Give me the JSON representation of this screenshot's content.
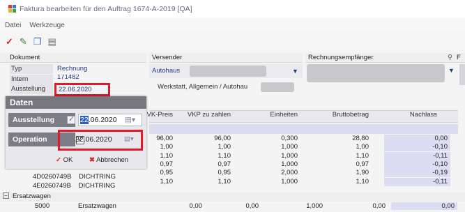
{
  "window": {
    "title": "Faktura bearbeiten für den Auftrag 1674-A-2019 [QA]"
  },
  "menu": {
    "items": [
      "Datei",
      "Werkzeuge"
    ]
  },
  "dokument": {
    "header": "Dokument",
    "typ_label": "Typ",
    "typ_value": "Rechnung",
    "intern_label": "Intern",
    "intern_value": "171482",
    "ausstellung_label": "Ausstellung",
    "ausstellung_value": "22.06.2020"
  },
  "versender": {
    "header": "Versender",
    "value": "Autohaus",
    "value2": "Werkstatt,  Allgemein / Autohau"
  },
  "empfaenger": {
    "header": "Rechnungsempfänger",
    "cut_label": "F"
  },
  "daten_popup": {
    "title": "Daten",
    "ausstellung_label": "Ausstellung",
    "ausstellung_date": "22.06.2020",
    "operation_label": "Operation",
    "operation_date": "22.06.2020",
    "ok_label": "OK",
    "cancel_label": "Abbrechen"
  },
  "grid": {
    "columns": [
      "VK-Preis",
      "VKP zu zahlen",
      "Einheiten",
      "Bruttobetrag",
      "Nachlass"
    ],
    "rows": [
      [
        "96,00",
        "96,00",
        "0,300",
        "28,80",
        "0,00"
      ],
      [
        "1,00",
        "1,00",
        "1,000",
        "1,00",
        "-0,10"
      ],
      [
        "1,10",
        "1,10",
        "1,000",
        "1,10",
        "-0,11"
      ],
      [
        "0,97",
        "0,97",
        "1,000",
        "0,97",
        "-0,10"
      ],
      [
        "0,95",
        "0,95",
        "2,000",
        "1,90",
        "-0,19"
      ],
      [
        "1,10",
        "1,10",
        "1,000",
        "1,10",
        "-0,11"
      ]
    ],
    "left_rows": [
      {
        "code": "4D0260749B",
        "name": "DICHTRING",
        "cut_prefix": "0D0260740"
      },
      {
        "code": "4D0260749B",
        "name": "DICHTRING"
      },
      {
        "code": "4E0260749B",
        "name": "DICHTRING"
      }
    ],
    "group_label": "Ersatzwagen",
    "ersatz_row": {
      "code": "5000",
      "name": "Ersatzwagen",
      "vk": "0,00",
      "vkp": "0,00",
      "einh": "1,000",
      "brutto": "0,00",
      "nachlass": "0,00"
    }
  },
  "colors": {
    "highlight": "#e0192b",
    "nachlass_bg": "#dcdcf2",
    "date_select": "#2b5fbf"
  }
}
